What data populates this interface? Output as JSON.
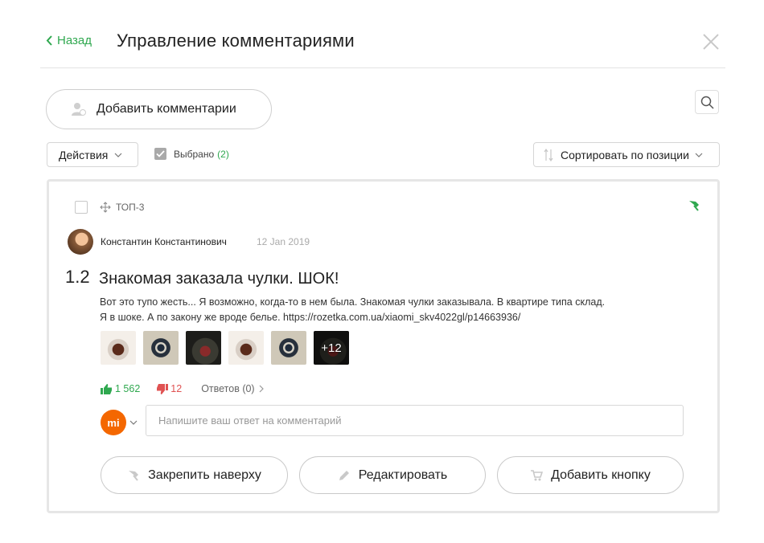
{
  "header": {
    "back_label": "Назад",
    "title": "Управление комментариями"
  },
  "toolbar": {
    "add_comments_label": "Добавить комментарии",
    "actions_label": "Действия",
    "selected_label": "Выбрано",
    "selected_count": "(2)",
    "sort_label": "Сортировать по позиции"
  },
  "comment": {
    "tag": "ТОП-3",
    "author": "Константин Константинович",
    "date": "12 Jan 2019",
    "number": "1.2",
    "title": "Знакомая заказала чулки. ШОК!",
    "text_line1": "Вот это тупо жесть... Я возможно, когда-то в нем была. Знакомая чулки заказывала. В квартире типа склад.",
    "text_line2": "Я в шоке. А по закону же вроде белье. https://rozetka.com.ua/xiaomi_skv4022gl/p14663936/",
    "more_images": "+12",
    "likes": "1 562",
    "dislikes": "12",
    "answers": "Ответов (0)",
    "reply_brand": "mi",
    "reply_placeholder": "Напишите ваш ответ на комментарий",
    "pin_button": "Закрепить наверху",
    "edit_button": "Редактировать",
    "add_button": "Добавить кнопку"
  },
  "colors": {
    "accent": "#2fa84f",
    "dislike": "#e05252",
    "brand_xiaomi": "#f46700"
  },
  "icons": [
    "chevron-left-icon",
    "close-icon",
    "user-add-icon",
    "search-icon",
    "chevron-down-icon",
    "check-icon",
    "sort-icon",
    "drag-icon",
    "pin-icon",
    "thumb-up-icon",
    "thumb-down-icon",
    "chevron-right-icon",
    "pencil-icon",
    "cart-icon"
  ]
}
